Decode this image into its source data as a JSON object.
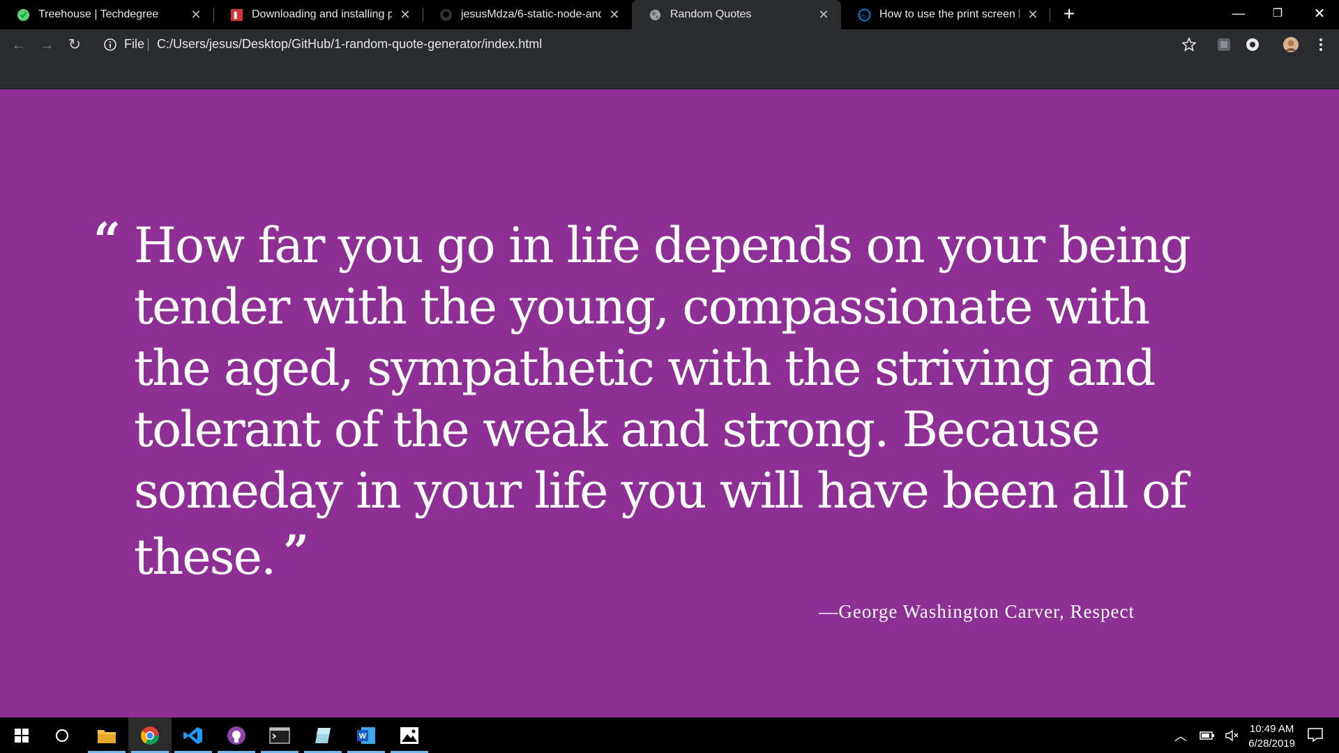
{
  "browser": {
    "tabs": [
      {
        "title": "Treehouse | Techdegree",
        "icon": "treehouse-icon",
        "active": false
      },
      {
        "title": "Downloading and installing pack",
        "icon": "npm-icon",
        "active": false
      },
      {
        "title": "jesusMdza/6-static-node-and-ex",
        "icon": "github-icon",
        "active": false
      },
      {
        "title": "Random Quotes",
        "icon": "globe-icon",
        "active": true
      },
      {
        "title": "How to use the print screen key i",
        "icon": "dell-icon",
        "active": false
      }
    ],
    "new_tab_label": "+",
    "window_controls": {
      "minimize": "—",
      "restore": "❐",
      "close": "✕"
    }
  },
  "toolbar": {
    "back": "←",
    "forward": "→",
    "reload": "↻",
    "scheme_label": "File",
    "url": "C:/Users/jesus/Desktop/GitHub/1-random-quote-generator/index.html"
  },
  "page": {
    "background_color": "#8e2f96",
    "open_quote": "“",
    "quote": "How far you go in life depends on your being tender with the young, compassionate with the aged, sympathetic with the striving and tolerant of the weak and strong. Because someday in your life you will have been all of these.",
    "close_quote": "”",
    "source": "—George Washington Carver, Respect"
  },
  "taskbar": {
    "apps": [
      "windows-start-icon",
      "cortana-icon",
      "file-explorer-icon",
      "chrome-icon",
      "vscode-icon",
      "github-desktop-icon",
      "terminal-icon",
      "notes-icon",
      "word-icon",
      "photos-icon"
    ],
    "time": "10:49 AM",
    "date": "6/28/2019"
  }
}
